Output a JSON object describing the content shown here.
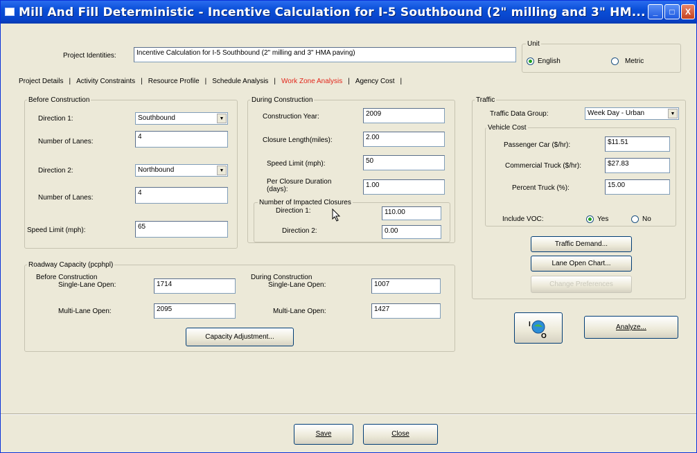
{
  "window": {
    "title": "Mill And Fill Deterministic - Incentive Calculation for I-5 Southbound (2\" milling and 3\" HM...",
    "buttons": {
      "minimize": "_",
      "maximize": "□",
      "close": "X"
    }
  },
  "project": {
    "identities_label": "Project Identities:",
    "identities_value": "Incentive Calculation for I-5 Southbound (2\" milling and 3\" HMA paving)"
  },
  "unit": {
    "title": "Unit",
    "english_label": "English",
    "metric_label": "Metric",
    "selected": "English"
  },
  "tabs": [
    {
      "label": "Project Details"
    },
    {
      "label": "Activity Constraints"
    },
    {
      "label": "Resource Profile"
    },
    {
      "label": "Schedule Analysis"
    },
    {
      "label": "Work Zone Analysis",
      "active": true
    },
    {
      "label": "Agency Cost"
    }
  ],
  "before_construction": {
    "title": "Before Construction",
    "direction1_label": "Direction 1:",
    "direction1_value": "Southbound",
    "lanes1_label": "Number of Lanes:",
    "lanes1_value": "4",
    "direction2_label": "Direction 2:",
    "direction2_value": "Northbound",
    "lanes2_label": "Number of Lanes:",
    "lanes2_value": "4",
    "speed_label": "Speed Limit (mph):",
    "speed_value": "65"
  },
  "during_construction": {
    "title": "During Construction",
    "year_label": "Construction Year:",
    "year_value": "2009",
    "closure_length_label": "Closure Length(miles):",
    "closure_length_value": "2.00",
    "speed_label": "Speed Limit (mph):",
    "speed_value": "50",
    "duration_label_1": "Per Closure Duration",
    "duration_label_2": "(days):",
    "duration_value": "1.00",
    "impacted_label": "Number of Impacted Closures",
    "impacted_dir1_label": "Direction 1:",
    "impacted_dir1_value": "110.00",
    "impacted_dir2_label": "Direction 2:",
    "impacted_dir2_value": "0.00"
  },
  "traffic": {
    "title": "Traffic",
    "group_label": "Traffic Data Group:",
    "group_value": "Week Day - Urban",
    "vehicle_cost_title": "Vehicle Cost",
    "passenger_label": "Passenger Car ($/hr):",
    "passenger_value": "$11.51",
    "truck_label": "Commercial Truck ($/hr):",
    "truck_value": "$27.83",
    "percent_label": "Percent Truck (%):",
    "percent_value": "15.00",
    "voc_label": "Include VOC:",
    "voc_yes": "Yes",
    "voc_no": "No",
    "voc_selected": "Yes",
    "demand_button": "Traffic Demand...",
    "lane_chart_button": "Lane Open Chart...",
    "disabled_button": "Change Preferences"
  },
  "roadway_capacity": {
    "title": "Roadway Capacity (pcphpl)",
    "before_title": "Before Construction",
    "before_single_label": "Single-Lane Open:",
    "before_single_value": "1714",
    "before_multi_label": "Multi-Lane Open:",
    "before_multi_value": "2095",
    "during_title": "During Construction",
    "during_single_label": "Single-Lane Open:",
    "during_single_value": "1007",
    "during_multi_label": "Multi-Lane Open:",
    "during_multi_value": "1427",
    "adjustment_button": "Capacity Adjustment..."
  },
  "actions": {
    "io_button_label": "I/O",
    "analyze_button": "Analyze...",
    "save_button": "Save",
    "close_button": "Close"
  }
}
